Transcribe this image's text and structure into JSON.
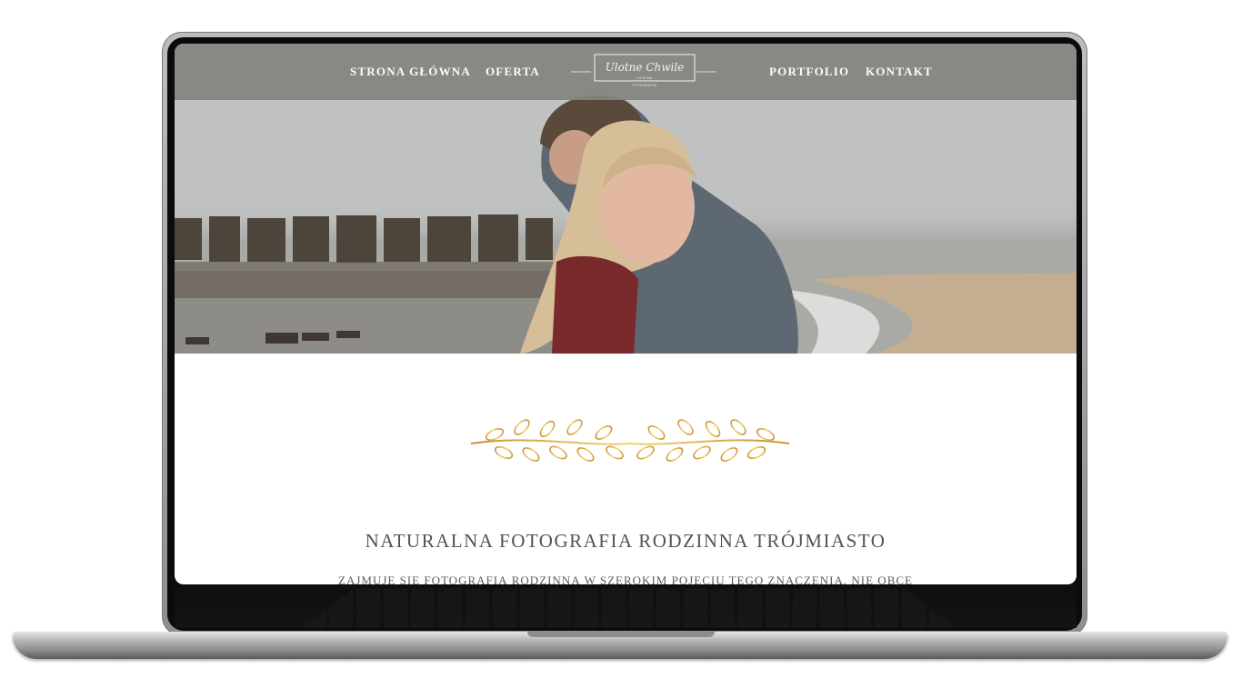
{
  "nav": {
    "items": [
      {
        "label": "STRONA GŁÓWNA"
      },
      {
        "label": "OFERTA"
      },
      {
        "label": "PORTFOLIO"
      },
      {
        "label": "KONTAKT"
      }
    ]
  },
  "logo": {
    "script_text": "Ulotne Chwile",
    "sub_line1": "FILIPIAK",
    "sub_line2": "FOTOGRAFIA"
  },
  "main": {
    "heading": "NATURALNA FOTOGRAFIA RODZINNA TRÓJMIASTO",
    "intro": "ZAJMUJĘ SIĘ FOTOGRAFIĄ RODZINNĄ W SZEROKIM POJĘCIU TEGO ZNACZENIA. NIE OBCE MI SĄ ZABAWY Z DZIEĆMI PODCZAS SESJI CZY SZALONE IMPREZY RODZINNE. ZAPRASZAM"
  },
  "colors": {
    "header_bg": "#82857f",
    "nav_text": "#fbfbf8",
    "ornament_gold": "#d4a83a",
    "heading_text": "#505553"
  },
  "icons": {
    "ornament": "laurel-branch-icon"
  }
}
